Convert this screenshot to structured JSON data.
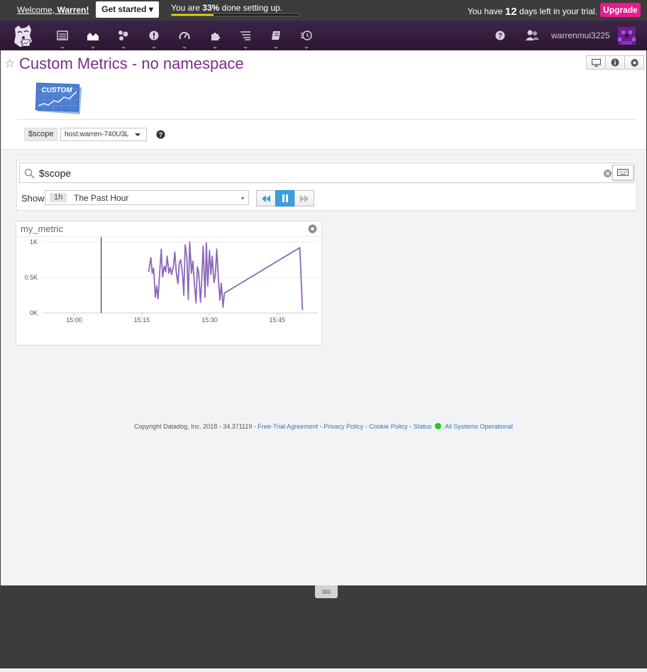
{
  "trial_bar": {
    "welcome_prefix": "Welcome,",
    "welcome_name": "Warren!",
    "get_started_label": "Get started ▾",
    "progress_prefix": "You are",
    "progress_percent": "33%",
    "progress_suffix": "done setting up.",
    "progress_value": 0.33,
    "trial_prefix": "You have",
    "trial_days": "12",
    "trial_suffix": "days left in your trial.",
    "upgrade_label": "Upgrade"
  },
  "nav": {
    "items": [
      {
        "icon": "events-icon"
      },
      {
        "icon": "dashboards-icon"
      },
      {
        "icon": "infrastructure-icon"
      },
      {
        "icon": "monitors-icon"
      },
      {
        "icon": "apm-icon"
      },
      {
        "icon": "integrations-icon"
      },
      {
        "icon": "logs-icon"
      },
      {
        "icon": "notebooks-icon"
      },
      {
        "icon": "synthetics-icon"
      }
    ],
    "active_index": 1,
    "username": "warrenmui3225"
  },
  "dashboard": {
    "title": "Custom Metrics - no namespace",
    "badge_text": "CUSTOM",
    "scope_variable": "$scope",
    "scope_value": "host:warren-740U3L"
  },
  "search": {
    "query": "$scope"
  },
  "timeframe": {
    "show_label": "Show",
    "chip": "1h",
    "label": "The Past Hour",
    "caret": "▾"
  },
  "widget": {
    "title": "my_metric"
  },
  "chart_data": {
    "type": "line",
    "title": "my_metric",
    "xlabel": "",
    "ylabel": "",
    "x_ticks": [
      "15:00",
      "15:15",
      "15:30",
      "15:45"
    ],
    "y_ticks": [
      "0K",
      "0.5K",
      "1K"
    ],
    "ylim": [
      0,
      1050
    ],
    "xlim_minutes": [
      0,
      61
    ],
    "x_unit": "minutes after 14:53",
    "marker_x": 13,
    "series": [
      {
        "name": "",
        "color": "#8b67b8",
        "x": [
          23.5,
          24.0,
          24.3,
          24.6,
          25.0,
          25.3,
          25.6,
          26.0,
          26.3,
          26.6,
          27.0,
          27.3,
          27.6,
          28.0,
          28.3,
          28.6,
          29.0,
          29.3,
          29.6,
          30.0,
          30.3,
          30.6,
          31.0,
          31.3,
          31.6,
          32.0,
          32.3,
          32.6,
          33.0,
          33.3,
          33.6,
          34.0,
          34.3,
          34.6,
          35.0,
          35.3,
          35.6,
          36.0,
          36.3,
          36.6,
          37.0,
          37.3,
          37.6,
          38.0,
          38.3,
          38.6,
          39.0,
          39.3,
          39.6,
          40.0,
          40.3,
          57.0,
          57.3,
          57.6
        ],
        "values": [
          580,
          780,
          560,
          630,
          220,
          380,
          200,
          620,
          900,
          510,
          660,
          580,
          800,
          560,
          640,
          540,
          660,
          860,
          590,
          410,
          700,
          750,
          560,
          250,
          960,
          780,
          190,
          1000,
          560,
          730,
          450,
          140,
          650,
          570,
          150,
          500,
          940,
          220,
          990,
          380,
          880,
          540,
          800,
          430,
          540,
          900,
          440,
          180,
          420,
          80,
          280,
          920,
          480,
          40
        ]
      }
    ]
  },
  "footer": {
    "copyright": "Copyright Datadog, Inc. 2018 - 34.371119 -",
    "sep": "-",
    "links": [
      "Free-Trial Agreement",
      "Privacy Policy",
      "Cookie Policy",
      "Status"
    ],
    "status_text": "All Systems Operational",
    "status_color": "#1ecc1e"
  },
  "colors": {
    "brand_purple": "#7c2c88",
    "nav_bg": "#2c1733",
    "upgrade_pink": "#ea1a8f",
    "progress_yellow": "#f5d90a",
    "playback_active": "#3a9fe0",
    "series_line": "#8b67b8"
  }
}
